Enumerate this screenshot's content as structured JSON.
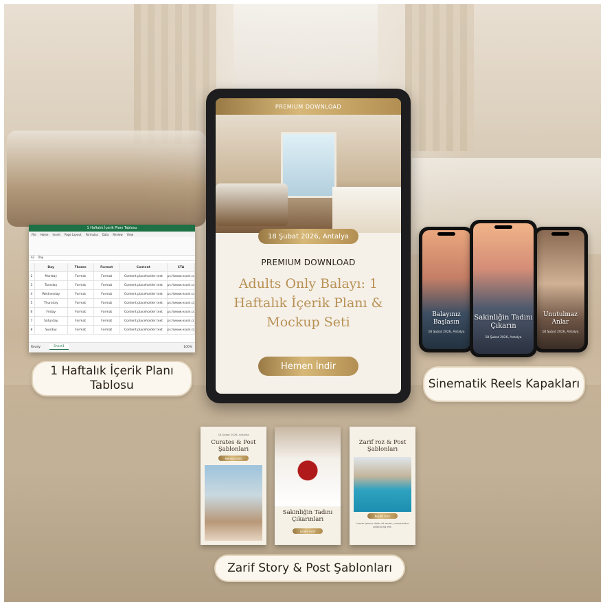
{
  "tablet": {
    "top_banner": "PREMIUM DOWNLOAD",
    "date_location": "18 Şubat 2026, Antalya",
    "subtitle": "PREMIUM DOWNLOAD",
    "title": "Adults Only Balayı: 1 Haftalık İçerik Planı & Mockup Seti",
    "cta": "Hemen İndir"
  },
  "labels": {
    "excel": "1 Haftalık İçerik Planı Tablosu",
    "reels": "Sinematik Reels Kapakları",
    "stories": "Zarif Story & Post Şablonları"
  },
  "excel": {
    "window_title": "1 Haftalık İçerik Planı Tablosu",
    "menu": [
      "File",
      "Home",
      "Insert",
      "Page Layout",
      "Formulas",
      "Data",
      "Review",
      "View"
    ],
    "name_box": "A2",
    "formula": "Day",
    "headers": [
      "Day",
      "Theme",
      "Format",
      "Content",
      "CTA"
    ],
    "rows": [
      [
        "Monday",
        "Format",
        "Format",
        "Content placeholder text",
        "https://www.excel.com/"
      ],
      [
        "Tuesday",
        "Format",
        "Format",
        "Content placeholder text",
        "https://www.excel.com/"
      ],
      [
        "Wednesday",
        "Format",
        "Format",
        "Content placeholder text",
        "https://www.excel.com/"
      ],
      [
        "Thursday",
        "Format",
        "Format",
        "Content placeholder text",
        "https://www.excel.com/"
      ],
      [
        "Friday",
        "Format",
        "Format",
        "Content placeholder text",
        "https://www.excel.com/"
      ],
      [
        "Saturday",
        "Format",
        "Format",
        "Content placeholder text",
        "https://www.excel.com/"
      ],
      [
        "Sunday",
        "Format",
        "Format",
        "Content placeholder text",
        "https://www.excel.com/"
      ]
    ],
    "sheet_tab": "Sheet1",
    "status": "Ready",
    "zoom": "100%"
  },
  "phones": [
    {
      "caption": "Balayınız Başlasın",
      "meta": "18 Şubat 2026, Antalya"
    },
    {
      "caption": "Sakinliğin Tadını Çıkarın",
      "meta": "18 Şubat 2026, Antalya"
    },
    {
      "caption": "Unutulmaz Anlar",
      "meta": "18 Şubat 2026, Antalya"
    }
  ],
  "cards": [
    {
      "meta": "18 Şubat 2026, Antalya",
      "title": "Curates & Post Şablonları",
      "button": "Hemen İndir"
    },
    {
      "title": "Sakinliğin Tadını Çıkarınları",
      "button": "Lorem İndir"
    },
    {
      "title": "Zarif roz & Post Şablonları",
      "button": "Keşfet İndir",
      "body": "Lorem ipsum dolor sit amet, consectetur adipiscing elit."
    }
  ],
  "colors": {
    "gold": "#c4a26a",
    "excel_green": "#1e7145",
    "cream": "#f5f0e8"
  }
}
